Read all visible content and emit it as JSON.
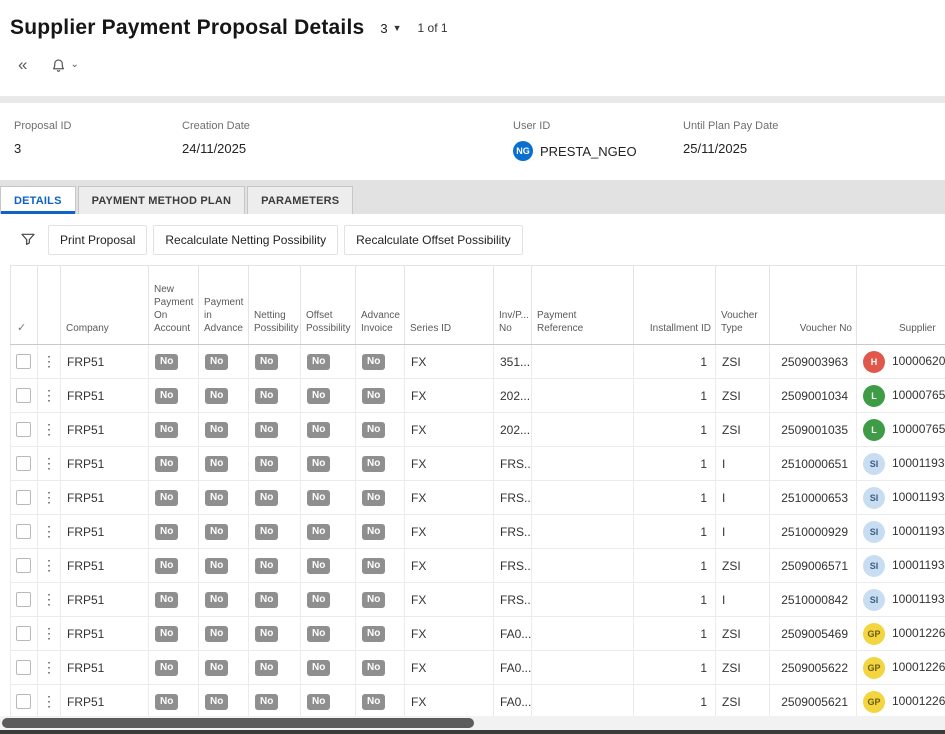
{
  "header": {
    "title": "Supplier Payment Proposal Details",
    "record_selector": "3",
    "record_count": "1 of 1"
  },
  "summary": {
    "fields": [
      {
        "label": "Proposal ID",
        "value": "3"
      },
      {
        "label": "Creation Date",
        "value": "24/11/2025"
      },
      {
        "label": "User ID",
        "value": "PRESTA_NGEO",
        "avatar_initials": "NG",
        "avatar_color": "#0b6fd1"
      },
      {
        "label": "Until Plan Pay Date",
        "value": "25/11/2025"
      }
    ]
  },
  "tabs": [
    {
      "label": "DETAILS",
      "active": true
    },
    {
      "label": "PAYMENT METHOD PLAN",
      "active": false
    },
    {
      "label": "PARAMETERS",
      "active": false
    }
  ],
  "toolbar": {
    "buttons": [
      {
        "label": "Print Proposal"
      },
      {
        "label": "Recalculate Netting Possibility"
      },
      {
        "label": "Recalculate Offset Possibility"
      }
    ]
  },
  "table": {
    "select_all_glyph": "✓",
    "columns": [
      "Company",
      "New Payment On Account",
      "Payment in Advance",
      "Netting Possibility",
      "Offset Possibility",
      "Advance Invoice",
      "Series ID",
      "Inv/P... No",
      "Payment Reference",
      "Installment ID",
      "Voucher Type",
      "Voucher No",
      "Supplier"
    ],
    "rows": [
      {
        "company": "FRP51",
        "new_payment_on_account": "No",
        "payment_in_advance": "No",
        "netting_possibility": "No",
        "offset_possibility": "No",
        "advance_invoice": "No",
        "series_id": "FX",
        "inv_no": "351...",
        "payment_reference": "",
        "installment_id": "1",
        "voucher_type": "ZSI",
        "voucher_no": "2509003963",
        "supplier": {
          "initials": "H",
          "color": "#e2574c",
          "text_color": "#ffffff",
          "id": "10000620 -"
        }
      },
      {
        "company": "FRP51",
        "new_payment_on_account": "No",
        "payment_in_advance": "No",
        "netting_possibility": "No",
        "offset_possibility": "No",
        "advance_invoice": "No",
        "series_id": "FX",
        "inv_no": "202...",
        "payment_reference": "",
        "installment_id": "1",
        "voucher_type": "ZSI",
        "voucher_no": "2509001034",
        "supplier": {
          "initials": "L",
          "color": "#3f9c46",
          "text_color": "#ffffff",
          "id": "10000765 -"
        }
      },
      {
        "company": "FRP51",
        "new_payment_on_account": "No",
        "payment_in_advance": "No",
        "netting_possibility": "No",
        "offset_possibility": "No",
        "advance_invoice": "No",
        "series_id": "FX",
        "inv_no": "202...",
        "payment_reference": "",
        "installment_id": "1",
        "voucher_type": "ZSI",
        "voucher_no": "2509001035",
        "supplier": {
          "initials": "L",
          "color": "#3f9c46",
          "text_color": "#ffffff",
          "id": "10000765 -"
        }
      },
      {
        "company": "FRP51",
        "new_payment_on_account": "No",
        "payment_in_advance": "No",
        "netting_possibility": "No",
        "offset_possibility": "No",
        "advance_invoice": "No",
        "series_id": "FX",
        "inv_no": "FRS...",
        "payment_reference": "",
        "installment_id": "1",
        "voucher_type": "I",
        "voucher_no": "2510000651",
        "supplier": {
          "initials": "SI",
          "color": "#c9ddf2",
          "text_color": "#3e5f82",
          "id": "10001193 -"
        }
      },
      {
        "company": "FRP51",
        "new_payment_on_account": "No",
        "payment_in_advance": "No",
        "netting_possibility": "No",
        "offset_possibility": "No",
        "advance_invoice": "No",
        "series_id": "FX",
        "inv_no": "FRS...",
        "payment_reference": "",
        "installment_id": "1",
        "voucher_type": "I",
        "voucher_no": "2510000653",
        "supplier": {
          "initials": "SI",
          "color": "#c9ddf2",
          "text_color": "#3e5f82",
          "id": "10001193 -"
        }
      },
      {
        "company": "FRP51",
        "new_payment_on_account": "No",
        "payment_in_advance": "No",
        "netting_possibility": "No",
        "offset_possibility": "No",
        "advance_invoice": "No",
        "series_id": "FX",
        "inv_no": "FRS...",
        "payment_reference": "",
        "installment_id": "1",
        "voucher_type": "I",
        "voucher_no": "2510000929",
        "supplier": {
          "initials": "SI",
          "color": "#c9ddf2",
          "text_color": "#3e5f82",
          "id": "10001193 -"
        }
      },
      {
        "company": "FRP51",
        "new_payment_on_account": "No",
        "payment_in_advance": "No",
        "netting_possibility": "No",
        "offset_possibility": "No",
        "advance_invoice": "No",
        "series_id": "FX",
        "inv_no": "FRS...",
        "payment_reference": "",
        "installment_id": "1",
        "voucher_type": "ZSI",
        "voucher_no": "2509006571",
        "supplier": {
          "initials": "SI",
          "color": "#c9ddf2",
          "text_color": "#3e5f82",
          "id": "10001193 -"
        }
      },
      {
        "company": "FRP51",
        "new_payment_on_account": "No",
        "payment_in_advance": "No",
        "netting_possibility": "No",
        "offset_possibility": "No",
        "advance_invoice": "No",
        "series_id": "FX",
        "inv_no": "FRS...",
        "payment_reference": "",
        "installment_id": "1",
        "voucher_type": "I",
        "voucher_no": "2510000842",
        "supplier": {
          "initials": "SI",
          "color": "#c9ddf2",
          "text_color": "#3e5f82",
          "id": "10001193 -"
        }
      },
      {
        "company": "FRP51",
        "new_payment_on_account": "No",
        "payment_in_advance": "No",
        "netting_possibility": "No",
        "offset_possibility": "No",
        "advance_invoice": "No",
        "series_id": "FX",
        "inv_no": "FA0...",
        "payment_reference": "",
        "installment_id": "1",
        "voucher_type": "ZSI",
        "voucher_no": "2509005469",
        "supplier": {
          "initials": "GP",
          "color": "#f2d53f",
          "text_color": "#6e5d11",
          "id": "10001226 -"
        }
      },
      {
        "company": "FRP51",
        "new_payment_on_account": "No",
        "payment_in_advance": "No",
        "netting_possibility": "No",
        "offset_possibility": "No",
        "advance_invoice": "No",
        "series_id": "FX",
        "inv_no": "FA0...",
        "payment_reference": "",
        "installment_id": "1",
        "voucher_type": "ZSI",
        "voucher_no": "2509005622",
        "supplier": {
          "initials": "GP",
          "color": "#f2d53f",
          "text_color": "#6e5d11",
          "id": "10001226 -"
        }
      },
      {
        "company": "FRP51",
        "new_payment_on_account": "No",
        "payment_in_advance": "No",
        "netting_possibility": "No",
        "offset_possibility": "No",
        "advance_invoice": "No",
        "series_id": "FX",
        "inv_no": "FA0...",
        "payment_reference": "",
        "installment_id": "1",
        "voucher_type": "ZSI",
        "voucher_no": "2509005621",
        "supplier": {
          "initials": "GP",
          "color": "#f2d53f",
          "text_color": "#6e5d11",
          "id": "10001226 -"
        }
      }
    ]
  }
}
